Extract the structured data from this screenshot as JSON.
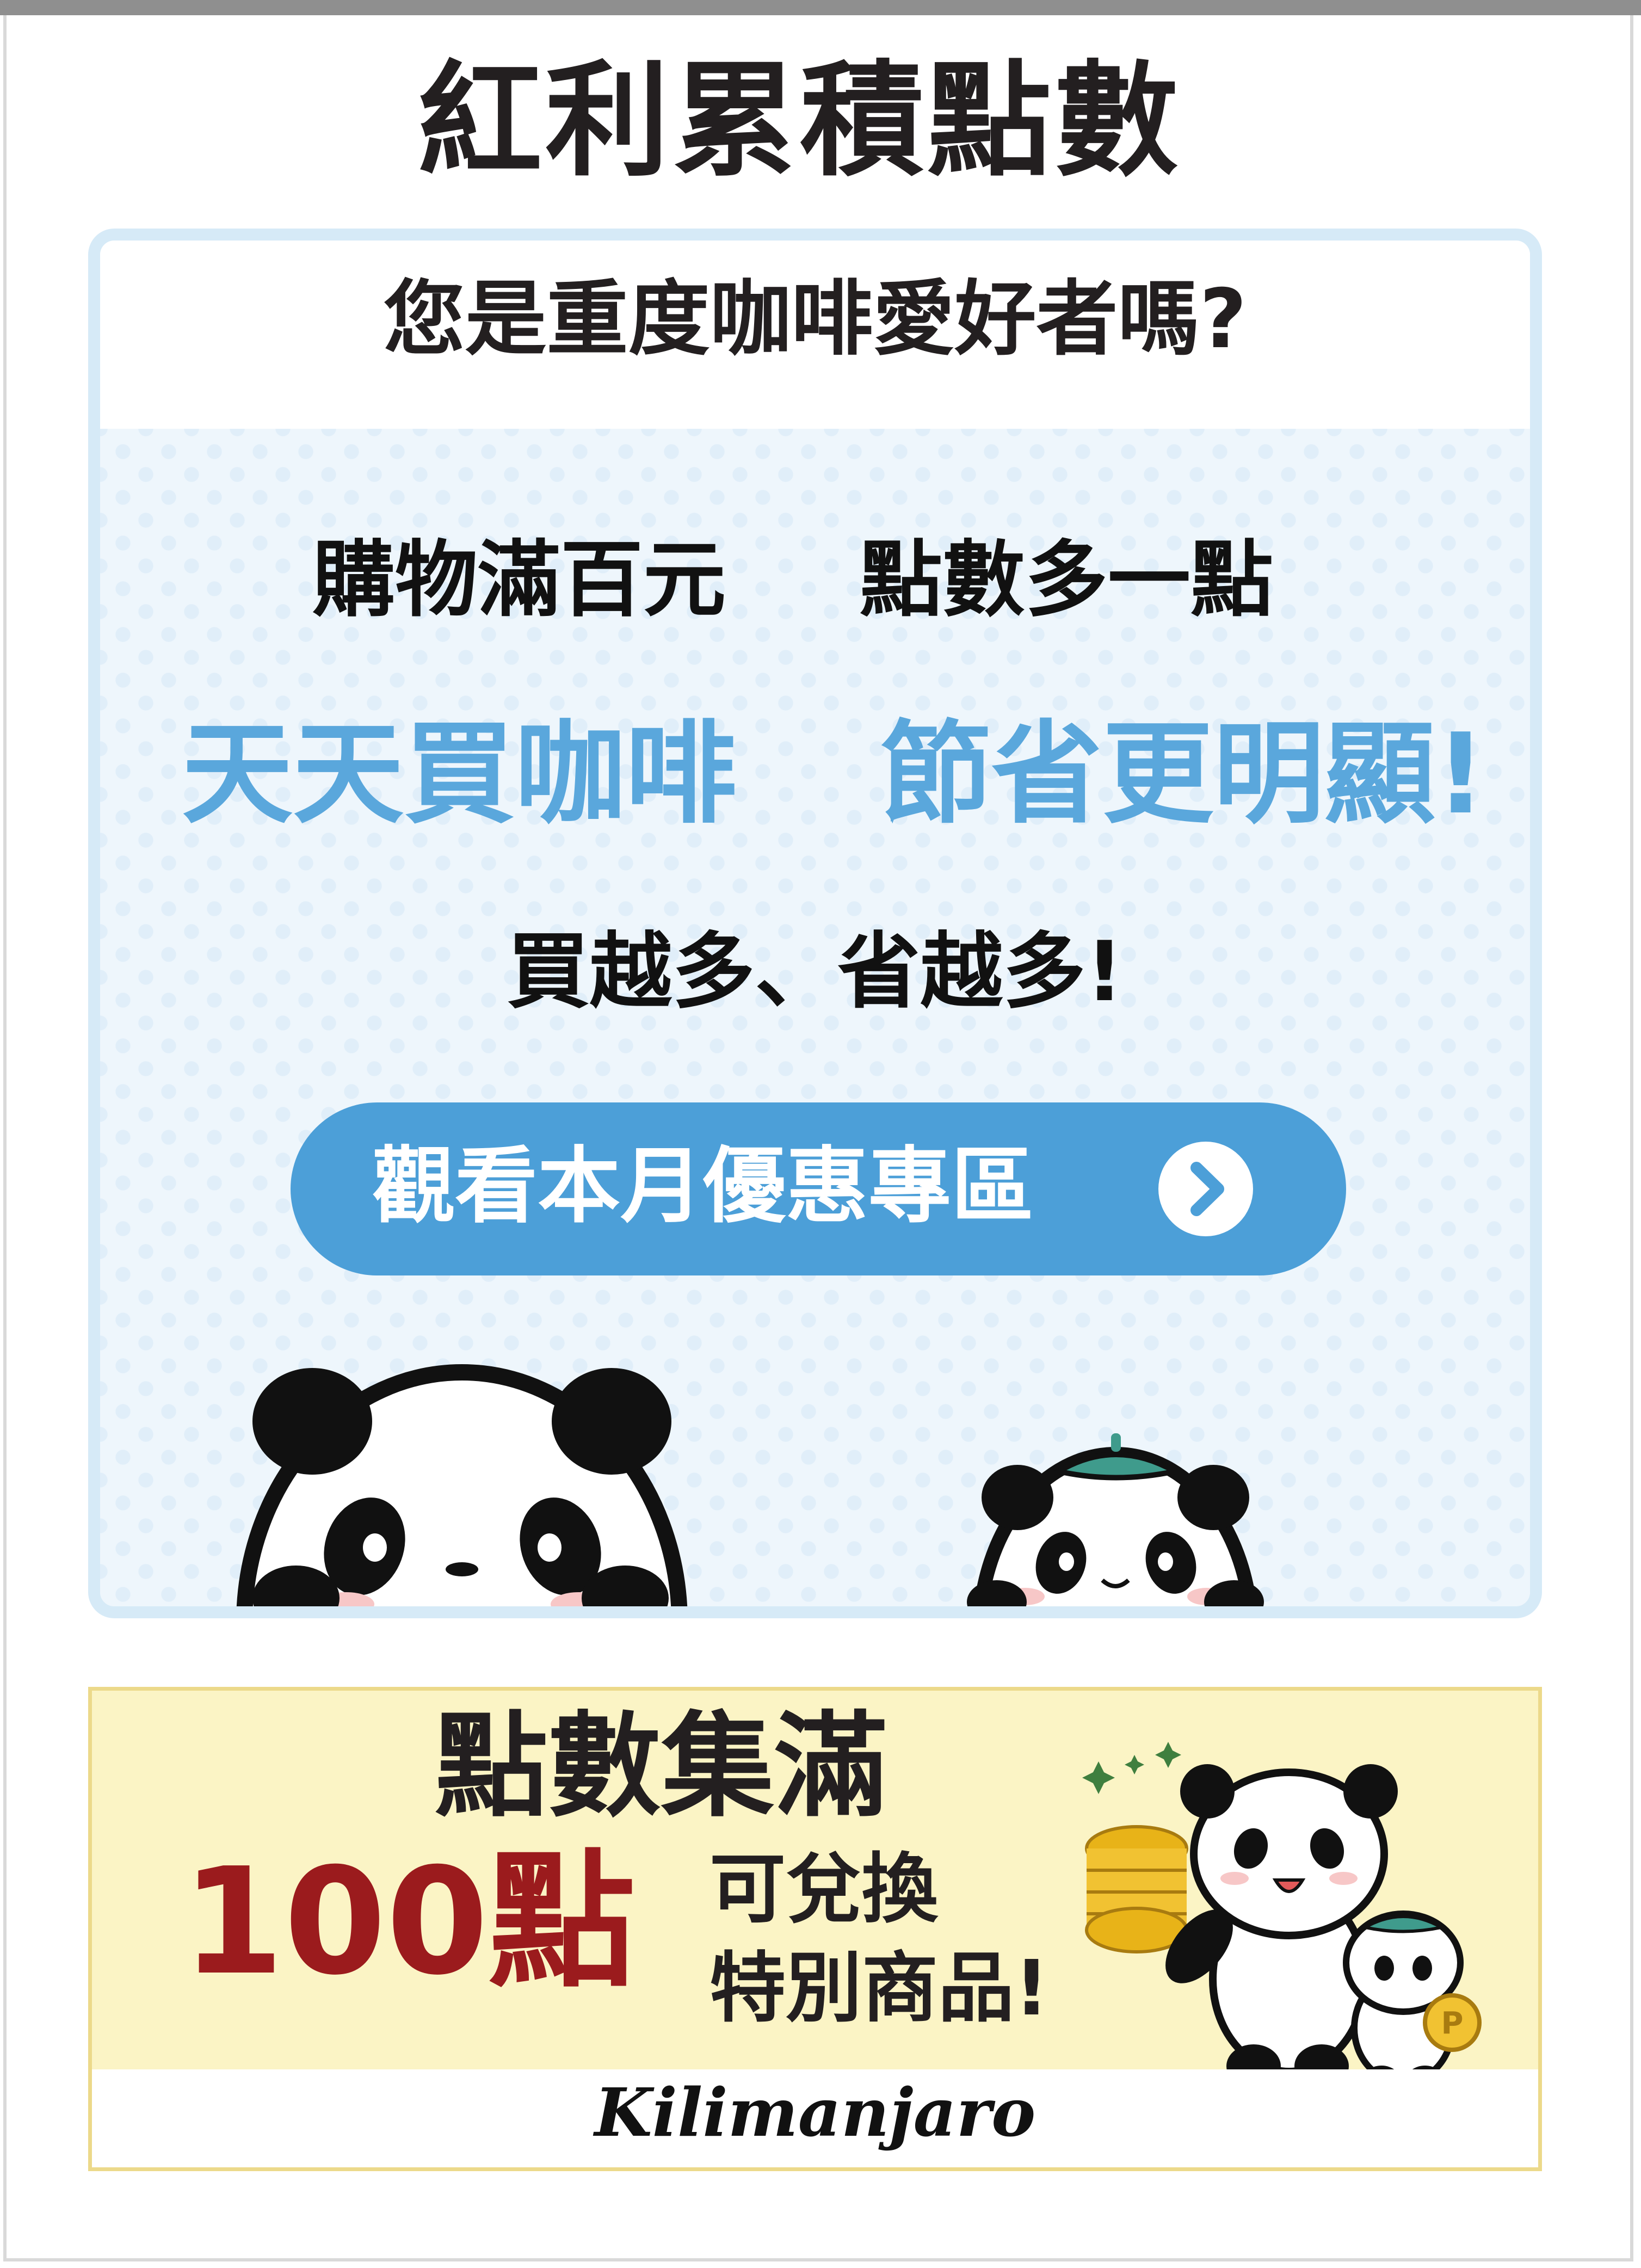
{
  "page": {
    "title": "紅利累積點數"
  },
  "promo": {
    "question": "您是重度咖啡愛好者嗎?",
    "line1_a": "購物滿百元",
    "line1_b": "點數多一點",
    "line2_a": "天天買咖啡",
    "line2_b": "節省更明顯!",
    "line3": "買越多、省越多!",
    "button_label": "觀看本月優惠專區"
  },
  "bonus": {
    "title": "點數集滿",
    "points": "100點",
    "desc_line1": "可兌換",
    "desc_line2": "特別商品!",
    "coin_label": "P"
  },
  "brand": {
    "name": "Kilimanjaro"
  },
  "colors": {
    "accent_blue": "#4c9fd8",
    "highlight_blue_text": "#5aa7dc",
    "points_red": "#9b1b1d",
    "bonus_bg": "#fbf4c5"
  }
}
